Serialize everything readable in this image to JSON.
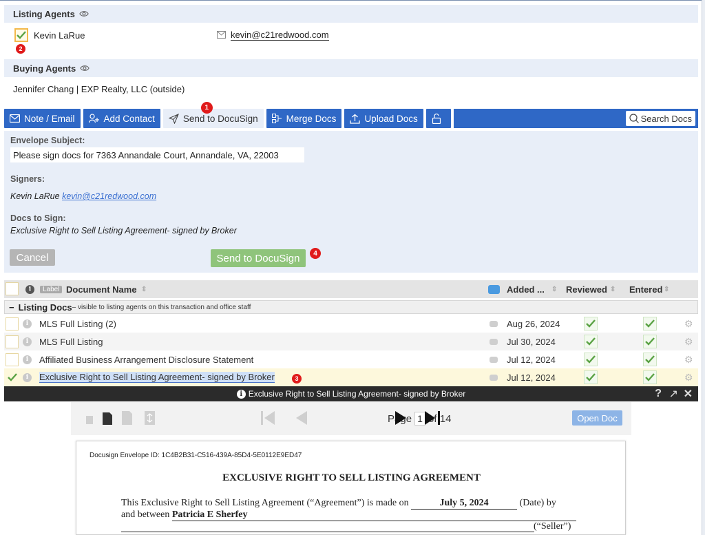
{
  "listing_agents": {
    "heading": "Listing Agents",
    "name": "Kevin LaRue",
    "email": "kevin@c21redwood.com",
    "step_badge": "2"
  },
  "buying_agents": {
    "heading": "Buying Agents",
    "line": "Jennifer Chang | EXP Realty, LLC (outside)"
  },
  "toolbar": {
    "note_email": "Note / Email",
    "add_contact": "Add Contact",
    "send_docusign": "Send to DocuSign",
    "send_badge": "1",
    "merge_docs": "Merge Docs",
    "upload_docs": "Upload Docs",
    "search_docs": "Search Docs"
  },
  "docusign_panel": {
    "subject_label": "Envelope Subject:",
    "subject_value": "Please sign docs for 7363 Annandale Court, Annandale, VA, 22003",
    "signers_label": "Signers:",
    "signer_name": "Kevin LaRue",
    "signer_email": "kevin@c21redwood.com",
    "docs_label": "Docs to Sign:",
    "docs_value": "Exclusive Right to Sell Listing Agreement- signed by Broker",
    "cancel": "Cancel",
    "send": "Send to DocuSign",
    "send_badge": "4"
  },
  "grid": {
    "label_tag": "Label",
    "col_document": "Document Name",
    "col_added": "Added ...",
    "col_reviewed": "Reviewed",
    "col_entered": "Entered",
    "group_name": "Listing Docs",
    "group_note": " – visible to listing agents on this transaction and office staff",
    "rows": [
      {
        "name": "MLS Full Listing (2)",
        "added": "Aug 26, 2024"
      },
      {
        "name": "MLS Full Listing",
        "added": "Jul 30, 2024"
      },
      {
        "name": "Affiliated Business Arrangement Disclosure Statement",
        "added": "Jul 12, 2024"
      },
      {
        "name": "Exclusive Right to Sell Listing Agreement- signed by Broker",
        "added": "Jul 12, 2024",
        "badge": "3"
      }
    ]
  },
  "viewer": {
    "title": "Exclusive Right to Sell Listing Agreement- signed by Broker",
    "help": "?",
    "page_label": "Page",
    "page_num": "1",
    "of_label": "of 14",
    "open_doc": "Open Doc"
  },
  "document": {
    "envelope_id": "Docusign Envelope ID: 1C4B2B31-C516-439A-85D4-5E0112E9ED47",
    "title": "EXCLUSIVE RIGHT TO SELL LISTING AGREEMENT",
    "line1_pre": "This Exclusive Right to Sell Listing Agreement (“Agreement”) is made on ",
    "line1_date": "July 5, 2024",
    "line1_post": " (Date) by",
    "line2_pre": "and between ",
    "line2_name": "Patricia E Sherfey",
    "seller": "(“Seller”)"
  },
  "colors": {
    "accent_blue": "#2f68c6",
    "panel_bg": "#e8eef8",
    "send_green": "#8fc47b",
    "badge_red": "#e01b1b"
  }
}
